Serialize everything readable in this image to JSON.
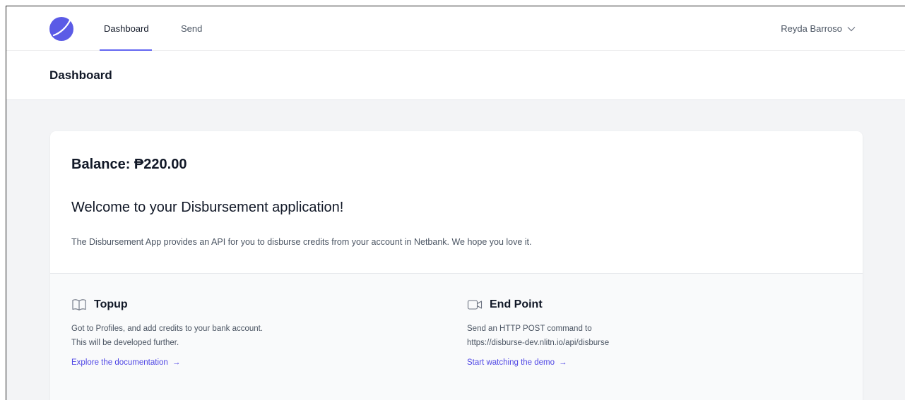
{
  "nav": {
    "tabs": [
      {
        "label": "Dashboard",
        "active": true
      },
      {
        "label": "Send",
        "active": false
      }
    ],
    "user_name": "Reyda Barroso",
    "accent_color": "#6366f1"
  },
  "header": {
    "title": "Dashboard"
  },
  "card": {
    "balance": "Balance: ₱220.00",
    "welcome": "Welcome to your Disbursement application!",
    "intro": "The Disbursement App provides an API for you to disburse credits from your account in Netbank. We hope you love it.",
    "features": [
      {
        "icon": "book-open-icon",
        "title": "Topup",
        "line1": "Got to Profiles, and add credits to your bank account.",
        "line2": "This will be developed further.",
        "link": "Explore the documentation"
      },
      {
        "icon": "video-camera-icon",
        "title": "End Point",
        "line1": "Send an HTTP POST command to",
        "line2": "https://disburse-dev.nlitn.io/api/disburse",
        "link": "Start watching the demo"
      }
    ]
  },
  "link_color": "#4f46e5"
}
